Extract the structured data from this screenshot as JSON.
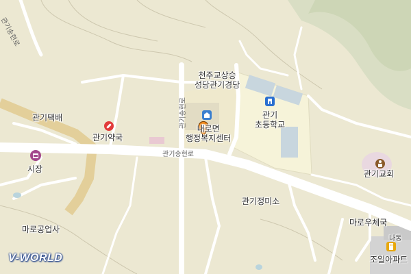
{
  "map": {
    "labels": {
      "church_cathedral": "천주교상승\n성당관기경당",
      "admin_center": "내로면\n행정복지센터",
      "elementary_school": "관기\n초등학교",
      "pharmacy": "관기약국",
      "taxi": "관기택배",
      "market": "시장",
      "church": "관기교회",
      "gas_station": "관기정미소",
      "post_office": "마로우체국",
      "industry": "마로공업사",
      "apartment_top": "나동",
      "apartment": "조일아파트"
    },
    "roads": {
      "main_road": "관기송현로",
      "vertical_road": "관기송현로",
      "topleft_road": "관기송현로"
    },
    "logo": "V-WORLD",
    "colors": {
      "background": "#ece8d2",
      "school_area": "#f6f3d9",
      "road": "#ffffff",
      "forest": "#d8dfc4",
      "marker": "#f08a1c"
    }
  }
}
